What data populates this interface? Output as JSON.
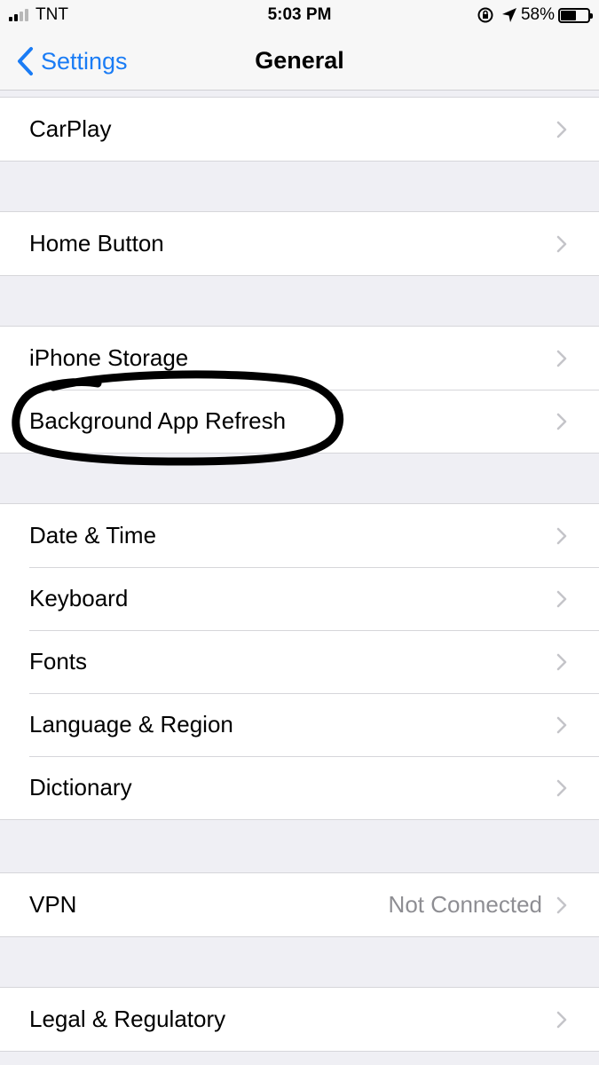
{
  "status_bar": {
    "carrier": "TNT",
    "time": "5:03 PM",
    "battery_percent_text": "58%",
    "battery_level": 0.58,
    "signal_bars_filled": 2,
    "signal_bars_total": 4
  },
  "nav": {
    "back_label": "Settings",
    "title": "General"
  },
  "rows": {
    "carplay": "CarPlay",
    "home_button": "Home Button",
    "iphone_storage": "iPhone Storage",
    "background_app_refresh": "Background App Refresh",
    "date_time": "Date & Time",
    "keyboard": "Keyboard",
    "fonts": "Fonts",
    "language_region": "Language & Region",
    "dictionary": "Dictionary",
    "vpn": "VPN",
    "vpn_status": "Not Connected",
    "legal_regulatory": "Legal & Regulatory"
  },
  "colors": {
    "accent": "#1a7cf5",
    "background": "#efeff4",
    "detail_text": "#8e8e93",
    "separator": "#d6d6da",
    "annotation": "#000000"
  },
  "icons": {
    "back": "chevron-left-icon",
    "disclosure": "chevron-right-icon",
    "orientation_lock": "orientation-lock-icon",
    "location": "location-arrow-icon",
    "battery": "battery-icon",
    "signal": "cellular-signal-icon"
  }
}
